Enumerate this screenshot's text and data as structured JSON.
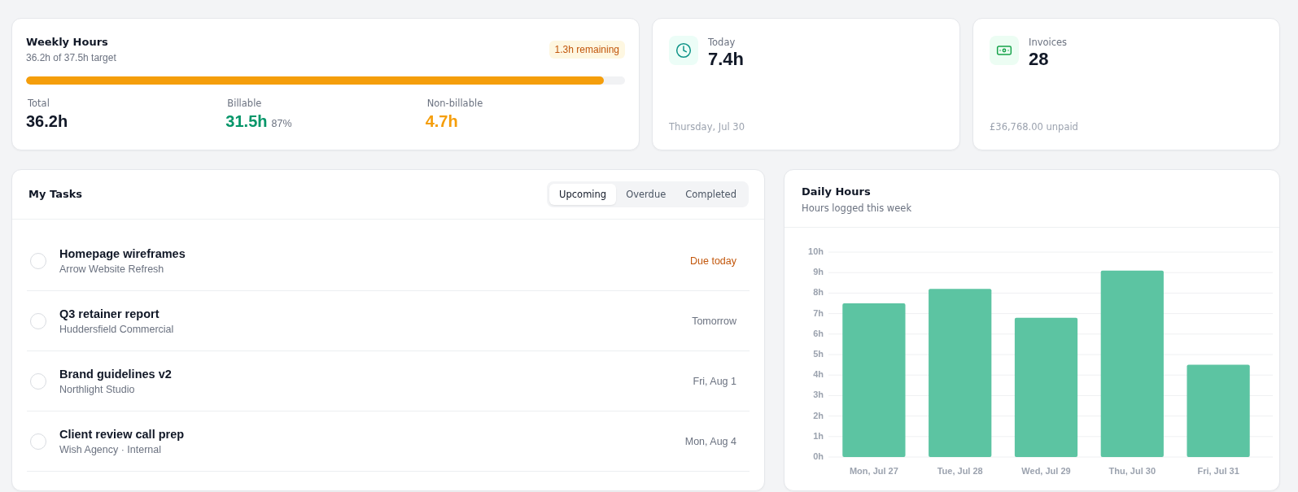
{
  "weekly_hours": {
    "title": "Weekly Hours",
    "subtitle": "36.2h of 37.5h target",
    "badge": "1.3h remaining",
    "progress": {
      "level": 0.965
    },
    "stats": [
      {
        "label": "Total",
        "value": "36.2h",
        "color": "#111827"
      },
      {
        "label": "Billable",
        "value": "31.5h",
        "note": "87%",
        "color": "#059669"
      },
      {
        "label": "Non-billable",
        "value": "4.7h",
        "color": "#f59e0b"
      }
    ]
  },
  "summary_cards": [
    {
      "kind": "time",
      "label": "Today",
      "value": "7.4h",
      "footer": "Thursday, Jul 30"
    },
    {
      "kind": "money",
      "label": "Invoices",
      "value": "28",
      "footer": "£36,768.00 unpaid"
    }
  ],
  "tasks": {
    "title": "My Tasks",
    "tabs": [
      {
        "label": "Upcoming",
        "selected": true
      },
      {
        "label": "Overdue",
        "selected": false
      },
      {
        "label": "Completed",
        "selected": false
      }
    ],
    "items": [
      {
        "title": "Homepage wireframes",
        "subtitle": "Arrow Website Refresh",
        "due": "Due today",
        "urgent": true,
        "checked": false
      },
      {
        "title": "Q3 retainer report",
        "subtitle": "Huddersfield Commercial",
        "due": "Tomorrow",
        "urgent": false,
        "checked": false
      },
      {
        "title": "Brand guidelines v2",
        "subtitle": "Northlight Studio",
        "due": "Fri, Aug 1",
        "urgent": false,
        "checked": false
      },
      {
        "title": "Client review call prep",
        "subtitle": "Wish Agency · Internal",
        "due": "Mon, Aug 4",
        "urgent": false,
        "checked": false
      }
    ]
  },
  "daily_hours": {
    "title": "Daily Hours",
    "subtitle": "Hours logged this week",
    "chart_data": {
      "type": "bar",
      "grid": true,
      "categories": [
        "Mon, Jul 27",
        "Tue, Jul 28",
        "Wed, Jul 29",
        "Thu, Jul 30",
        "Fri, Jul 31"
      ],
      "series": [
        {
          "color": "#5cc4a2",
          "values": [
            7.5,
            8.2,
            6.8,
            9.1,
            4.5
          ]
        }
      ],
      "ylim": [
        0,
        10
      ],
      "yticks": [
        {
          "value": 0,
          "label": "0h"
        },
        {
          "value": 1,
          "label": "1h"
        },
        {
          "value": 2,
          "label": "2h"
        },
        {
          "value": 3,
          "label": "3h"
        },
        {
          "value": 4,
          "label": "4h"
        },
        {
          "value": 5,
          "label": "5h"
        },
        {
          "value": 6,
          "label": "6h"
        },
        {
          "value": 7,
          "label": "7h"
        },
        {
          "value": 8,
          "label": "8h"
        },
        {
          "value": 9,
          "label": "9h"
        },
        {
          "value": 10,
          "label": "10h"
        }
      ]
    }
  }
}
